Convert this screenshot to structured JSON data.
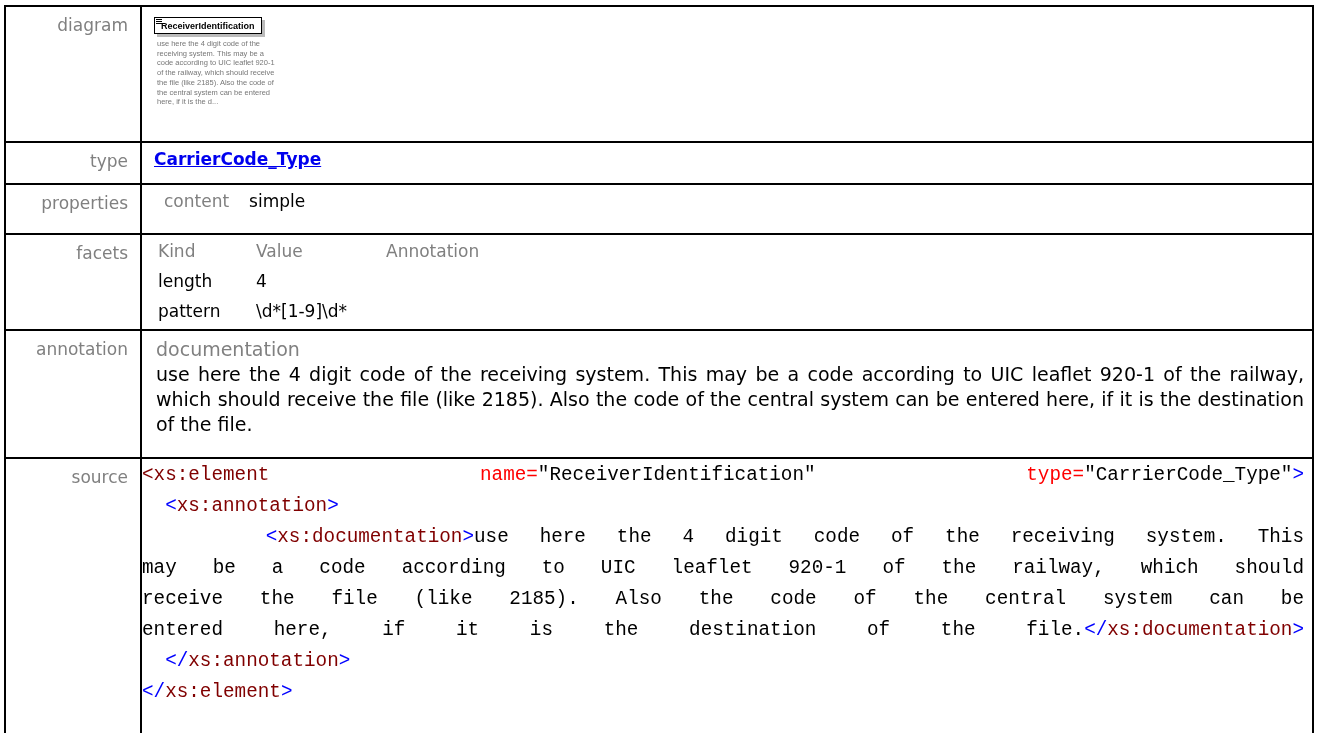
{
  "rows": [
    {
      "kind": "diagram",
      "label": "diagram",
      "element": {
        "name": "ReceiverIdentification",
        "description": "use here the 4 digit code of the receiving system. This may be a code according to UIC leaflet 920-1 of the railway, which should receive the file (like 2185). Also the code of the central system can be entered here, if it is the d..."
      }
    },
    {
      "kind": "link",
      "label": "type",
      "text": "CarrierCode_Type"
    },
    {
      "kind": "pairs",
      "label": "properties",
      "pairs": [
        {
          "key": "content",
          "value": "simple"
        }
      ]
    },
    {
      "kind": "facets",
      "label": "facets",
      "columns": [
        "Kind",
        "Value",
        "Annotation"
      ],
      "facets": [
        {
          "kind": "length",
          "value": "4"
        },
        {
          "kind": "pattern",
          "value": "\\d*[1-9]\\d*"
        }
      ]
    },
    {
      "kind": "annotation",
      "label": "annotation",
      "heading": "documentation",
      "text": "use here the 4 digit code of the receiving system. This may be a code according to UIC leaflet 920-1 of the railway, which should receive the file (like 2185). Also the code of the central system can be entered here, if it is the destination of the file."
    },
    {
      "kind": "source",
      "label": "source",
      "lines": [
        {
          "wrapped": true,
          "tokens": [
            {
              "kind": "tag",
              "text": "<xs:element"
            },
            {
              "kind": "attr",
              "text": "name="
            },
            {
              "kind": "value",
              "text": "\"ReceiverIdentification\""
            },
            {
              "kind": "attr",
              "text": "type="
            },
            {
              "kind": "value",
              "text": "\"CarrierCode_Type\""
            },
            {
              "kind": "punct",
              "text": ">"
            }
          ]
        },
        {
          "tokens": [
            {
              "kind": "punct",
              "text": "  <"
            },
            {
              "kind": "tag",
              "text": "xs:annotation"
            },
            {
              "kind": "punct",
              "text": ">"
            }
          ]
        },
        {
          "wrapped": true,
          "tokens": [
            {
              "kind": "punct",
              "text": "    <"
            },
            {
              "kind": "tag",
              "text": "xs:documentation"
            },
            {
              "kind": "punct",
              "text": ">"
            },
            {
              "kind": "text",
              "text": "use here the 4 digit code of the receiving system. This"
            }
          ]
        },
        {
          "wrapped": true,
          "tokens": [
            {
              "kind": "text",
              "text": "may be a code according to UIC leaflet 920-1 of the railway, which should"
            }
          ]
        },
        {
          "wrapped": true,
          "tokens": [
            {
              "kind": "text",
              "text": "receive the file (like 2185). Also the code of the central system can be"
            }
          ]
        },
        {
          "wrapped": true,
          "tokens": [
            {
              "kind": "text",
              "text": "entered here, if it is the destination of the file."
            },
            {
              "kind": "punct",
              "text": "</"
            },
            {
              "kind": "tag",
              "text": "xs:documentation"
            },
            {
              "kind": "punct",
              "text": ">"
            }
          ]
        },
        {
          "tokens": [
            {
              "kind": "punct",
              "text": "  </"
            },
            {
              "kind": "tag",
              "text": "xs:annotation"
            },
            {
              "kind": "punct",
              "text": ">"
            }
          ]
        },
        {
          "tokens": [
            {
              "kind": "punct",
              "text": "</"
            },
            {
              "kind": "tag",
              "text": "xs:element"
            },
            {
              "kind": "punct",
              "text": ">"
            }
          ]
        }
      ]
    }
  ]
}
